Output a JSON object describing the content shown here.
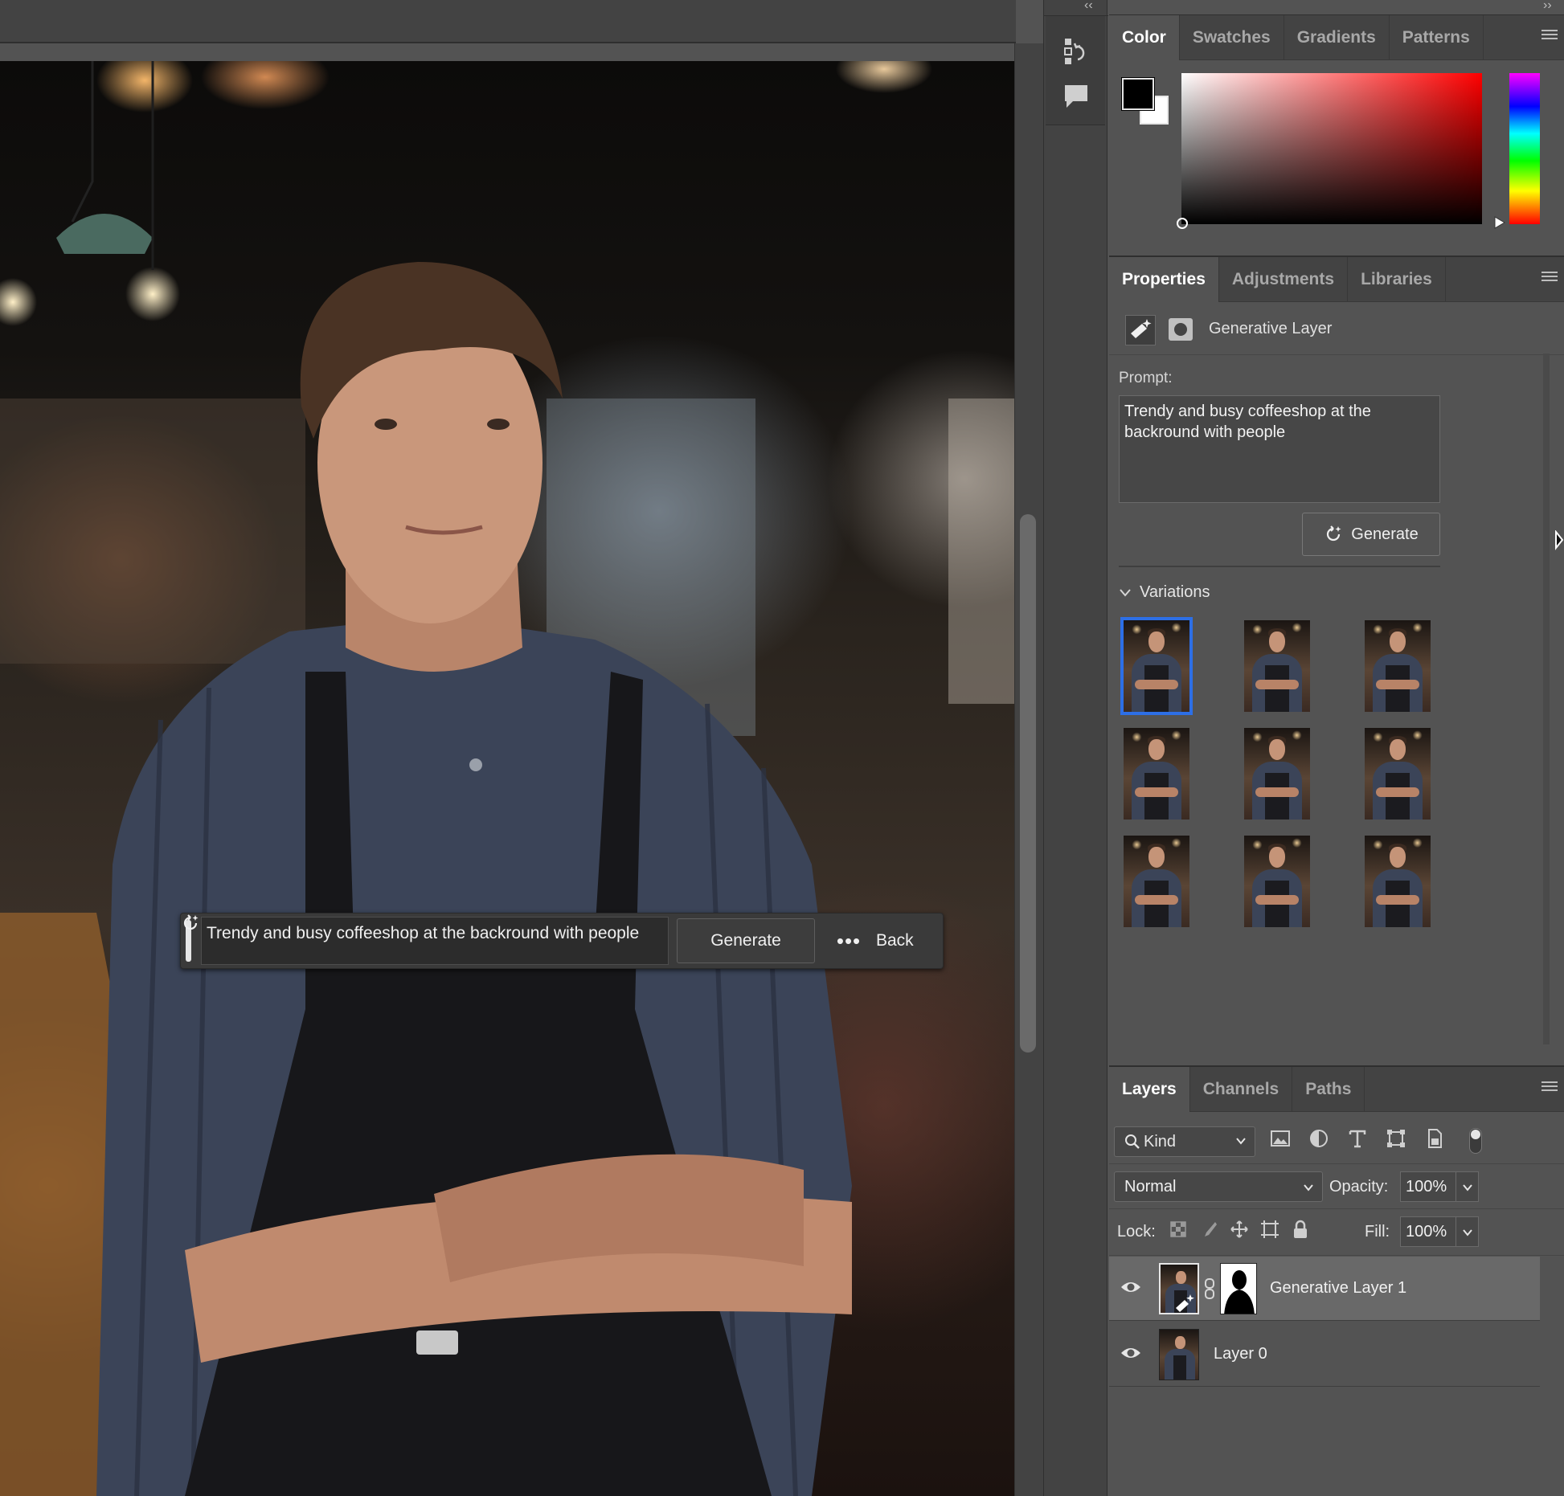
{
  "canvas": {
    "task_bar": {
      "prompt_value": "Trendy and busy coffeeshop at the backround with people",
      "generate_label": "Generate",
      "more_label": "•••",
      "back_label": "Back"
    }
  },
  "dock": {
    "collapse_left": "‹‹",
    "collapse_right": "››",
    "icons": [
      "history-icon",
      "comments-icon"
    ]
  },
  "color_panel": {
    "tabs": [
      "Color",
      "Swatches",
      "Gradients",
      "Patterns"
    ],
    "active_tab": "Color",
    "foreground_color": "#000000",
    "background_color": "#ffffff",
    "hue_color": "#ff0000"
  },
  "properties_panel": {
    "tabs": [
      "Properties",
      "Adjustments",
      "Libraries"
    ],
    "active_tab": "Properties",
    "layer_type": "Generative Layer",
    "prompt_label": "Prompt:",
    "prompt_value": "Trendy and busy coffeeshop at the backround with people",
    "generate_label": "Generate",
    "variations_label": "Variations",
    "variations_count": 9,
    "selected_variation": 1
  },
  "layers_panel": {
    "tabs": [
      "Layers",
      "Channels",
      "Paths"
    ],
    "active_tab": "Layers",
    "filter_kind": "Kind",
    "blend_mode": "Normal",
    "opacity_label": "Opacity:",
    "opacity_value": "100%",
    "lock_label": "Lock:",
    "fill_label": "Fill:",
    "fill_value": "100%",
    "layers": [
      {
        "name": "Generative Layer 1",
        "visible": true,
        "selected": true
      },
      {
        "name": "Layer 0",
        "visible": true,
        "selected": false
      }
    ]
  },
  "colors": {
    "panel_bg": "#535353",
    "tab_bar_bg": "#434343",
    "selection_accent": "#2d6fe6",
    "selected_layer_bg": "#696969"
  }
}
